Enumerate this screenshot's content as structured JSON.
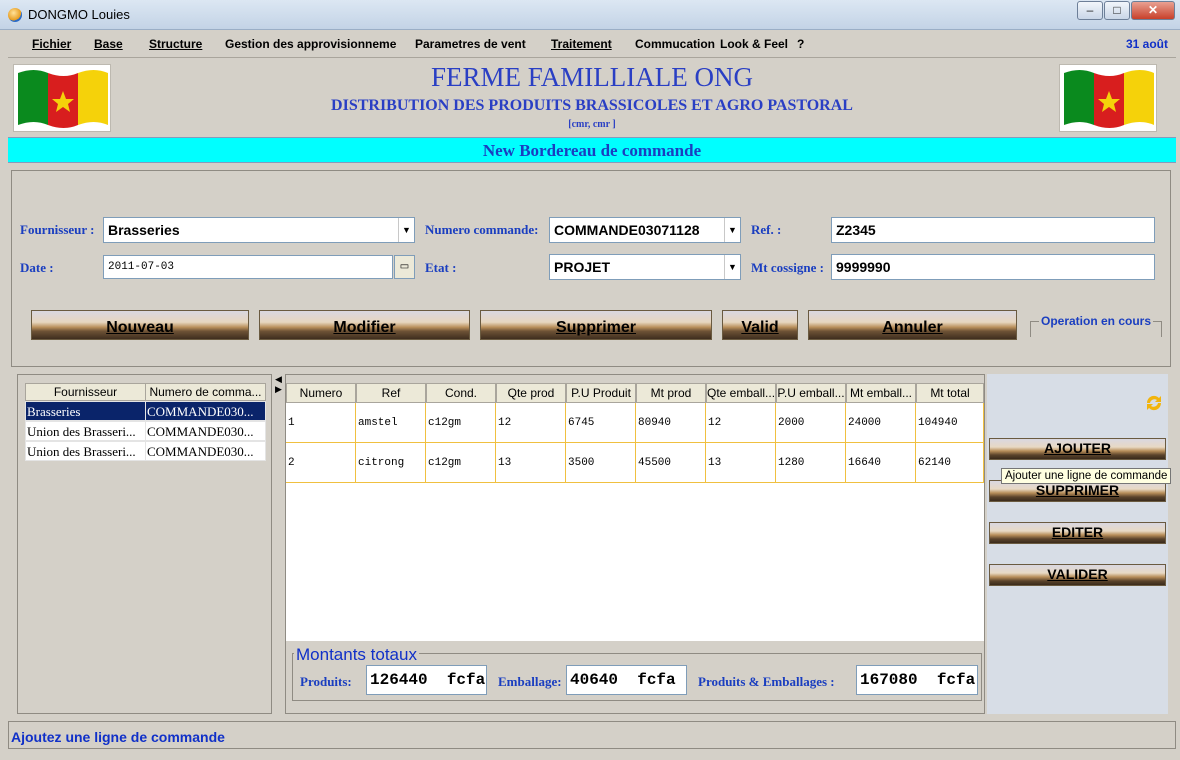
{
  "window": {
    "title": "DONGMO Louies",
    "minimize": "–",
    "maximize": "□",
    "close": "✕"
  },
  "menu": {
    "items": [
      "Fichier",
      "Base",
      "Structure",
      "Gestion des approvisionneme",
      "Parametres de vent",
      "Traitement",
      "Commucation",
      "Look & Feel",
      "?"
    ],
    "date": "31 août"
  },
  "header": {
    "company_name": "FERME FAMILLIALE ONG",
    "tagline": "DISTRIBUTION DES PRODUITS BRASSICOLES ET AGRO PASTORAL",
    "sub": "[cmr, cmr                    ]",
    "flag_colors": [
      "#0a8a1e",
      "#d81e1e",
      "#f5d20a"
    ]
  },
  "banner": {
    "title": "New  Bordereau de commande"
  },
  "form": {
    "fournisseur_label": "Fournisseur :",
    "fournisseur_value": "Brasseries",
    "numero_label": "Numero commande:",
    "numero_value": "COMMANDE03071128",
    "ref_label": "Ref. :",
    "ref_value": "Z2345",
    "date_label": "Date :",
    "date_value": "2011-07-03",
    "etat_label": "Etat :",
    "etat_value": "PROJET",
    "mt_label": "Mt cossigne :",
    "mt_value": "9999990",
    "buttons": {
      "nouveau": "Nouveau",
      "modifier": "Modifier",
      "supprimer": "Supprimer",
      "valid": "Valid",
      "annuler": "Annuler"
    },
    "operation_label": "Operation en cours"
  },
  "left_list": {
    "headers": [
      "Fournisseur",
      "Numero de comma..."
    ],
    "rows": [
      [
        "Brasseries",
        "COMMANDE030..."
      ],
      [
        "Union des Brasseri...",
        "COMMANDE030..."
      ],
      [
        "Union des Brasseri...",
        "COMMANDE030..."
      ]
    ]
  },
  "table": {
    "headers": [
      "Numero",
      "Ref",
      "Cond.",
      "Qte prod",
      "P.U Produit",
      "Mt prod",
      "Qte emball...",
      "P.U emball...",
      "Mt emball...",
      "Mt total"
    ],
    "rows": [
      [
        "1",
        "amstel",
        "c12gm",
        "12",
        "6745",
        "80940",
        "12",
        "2000",
        "24000",
        "104940"
      ],
      [
        "2",
        "citrong",
        "c12gm",
        "13",
        "3500",
        "45500",
        "13",
        "1280",
        "16640",
        "62140"
      ]
    ]
  },
  "totals": {
    "title": "Montants totaux",
    "produits_label": "Produits:",
    "produits_value": "126440  fcfa",
    "emballage_label": "Emballage:",
    "emballage_value": "40640  fcfa",
    "pe_label": "Produits & Emballages :",
    "pe_value": "167080  fcfa"
  },
  "side_buttons": {
    "ajouter": "AJOUTER",
    "supprimer": "SUPPRIMER",
    "editer": "EDITER",
    "valider": "VALIDER"
  },
  "tooltip": "Ajouter une ligne de commande",
  "status": "Ajoutez une ligne de commande"
}
